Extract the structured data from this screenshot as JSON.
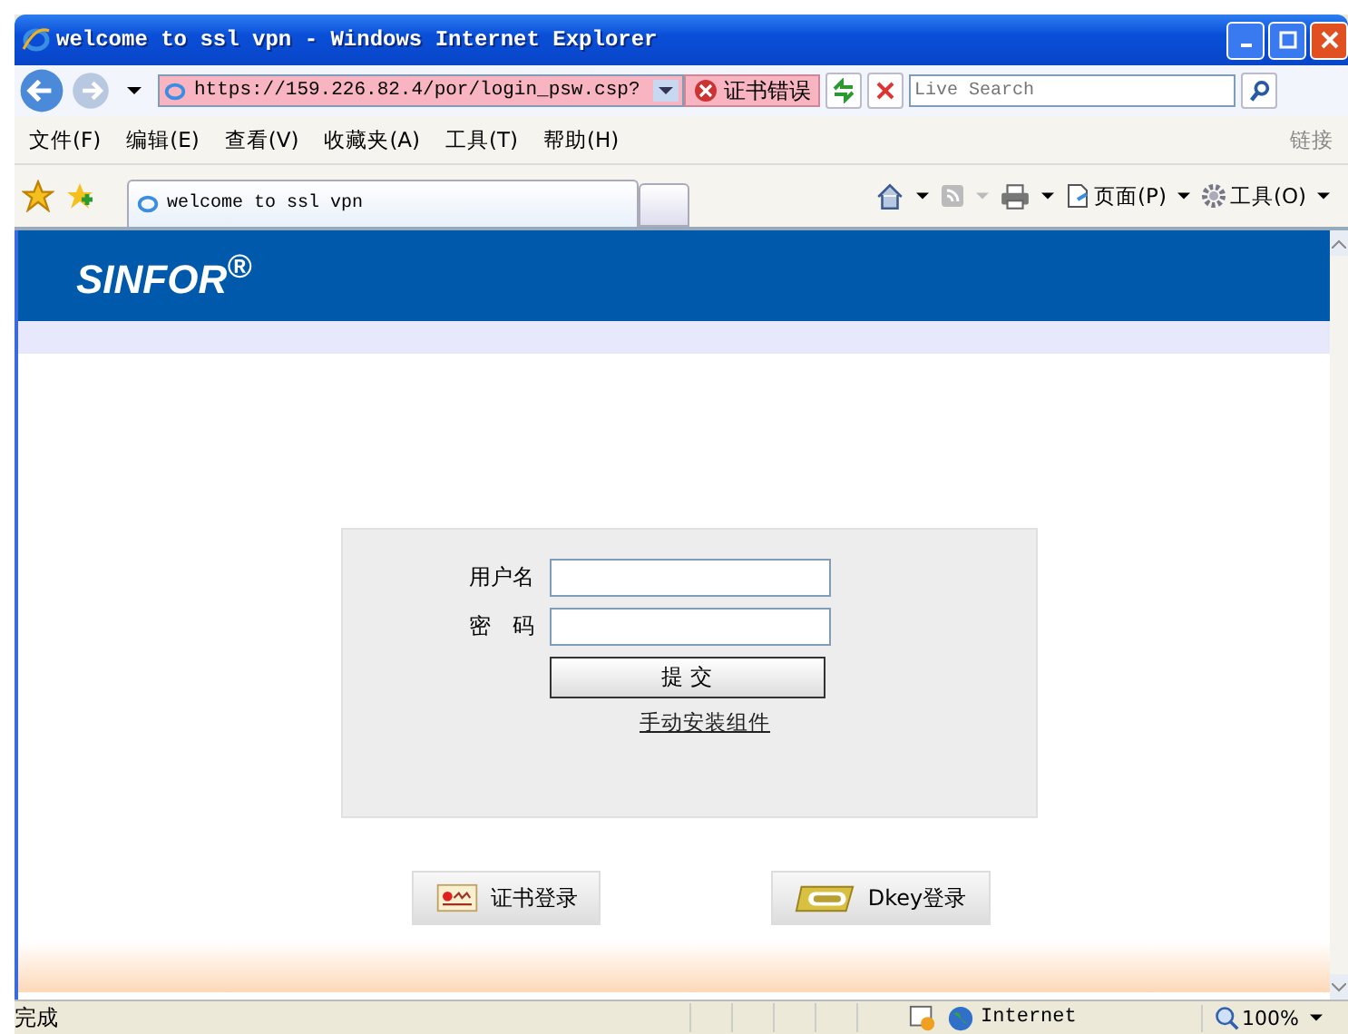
{
  "window": {
    "title": "welcome to ssl vpn - Windows Internet Explorer"
  },
  "address_bar": {
    "url": "https://159.226.82.4/por/login_psw.csp?",
    "cert_error": "证书错误",
    "search_placeholder": "Live Search"
  },
  "menu": [
    "文件(F)",
    "编辑(E)",
    "查看(V)",
    "收藏夹(A)",
    "工具(T)",
    "帮助(H)"
  ],
  "links_label": "链接",
  "tabs": [
    {
      "title": "welcome to ssl vpn",
      "selected": true
    }
  ],
  "command_bar": [
    "页面(P)",
    "工具(O)"
  ],
  "page": {
    "logo": "SINFOR$^{®}$",
    "fields": [
      {
        "label": "用户名"
      },
      {
        "label": "密　码"
      }
    ],
    "submit": "提 交",
    "install_link": "手动安装组件",
    "login_options": [
      {
        "kind": "certificate",
        "label": "证书登录"
      },
      {
        "kind": "usb",
        "label": "Dkey登录"
      }
    ]
  },
  "status_bar": {
    "status": "完成",
    "zone": "Internet",
    "zoom": "100%"
  }
}
